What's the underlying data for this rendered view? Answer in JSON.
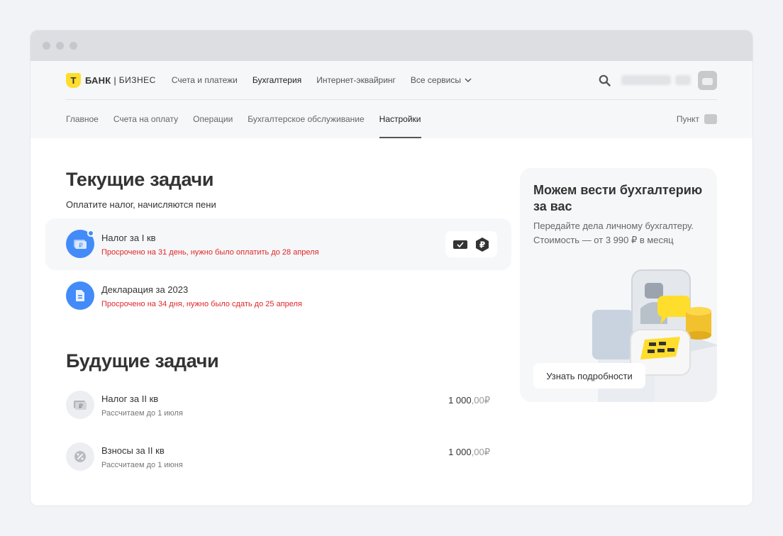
{
  "brand": {
    "shield_letter": "Т",
    "name": "БАНК",
    "separator": "|",
    "product": "БИЗНЕС"
  },
  "topnav": {
    "items": [
      {
        "label": "Счета и платежи",
        "active": false
      },
      {
        "label": "Бухгалтерия",
        "active": true
      },
      {
        "label": "Интернет-эквайринг",
        "active": false
      }
    ],
    "services_label": "Все сервисы"
  },
  "subnav": {
    "items": [
      {
        "label": "Главное",
        "active": false
      },
      {
        "label": "Счета на оплату",
        "active": false
      },
      {
        "label": "Операции",
        "active": false
      },
      {
        "label": "Бухгалтерское обслуживание",
        "active": false
      },
      {
        "label": "Настройки",
        "active": true
      }
    ],
    "punkt_label": "Пункт"
  },
  "current": {
    "title": "Текущие задачи",
    "hint": "Оплатите налог, начисляются пени",
    "tasks": [
      {
        "title": "Налог за I кв",
        "status": "Просрочено на 31 день, нужно было оплатить до 28 апреля"
      },
      {
        "title": "Декларация за 2023",
        "status": "Просрочено на 34 дня, нужно было сдать до 25 апреля"
      }
    ]
  },
  "future": {
    "title": "Будущие задачи",
    "tasks": [
      {
        "title": "Налог за II кв",
        "status": "Рассчитаем до 1 июля",
        "amount_int": "1 000",
        "amount_dec": ",00",
        "currency": "₽"
      },
      {
        "title": "Взносы за II кв",
        "status": "Рассчитаем до 1 июня",
        "amount_int": "1 000",
        "amount_dec": ",00",
        "currency": "₽"
      }
    ]
  },
  "promo": {
    "title": "Можем вести бухгалтерию за вас",
    "text": "Передайте дела личному бухгалтеру. Стоимость — от 3 990 ₽ в месяц",
    "button": "Узнать подробности"
  },
  "colors": {
    "accent": "#ffdd2d",
    "blue": "#428bf9",
    "overdue": "#e0262b",
    "bg": "#f2f3f7"
  }
}
